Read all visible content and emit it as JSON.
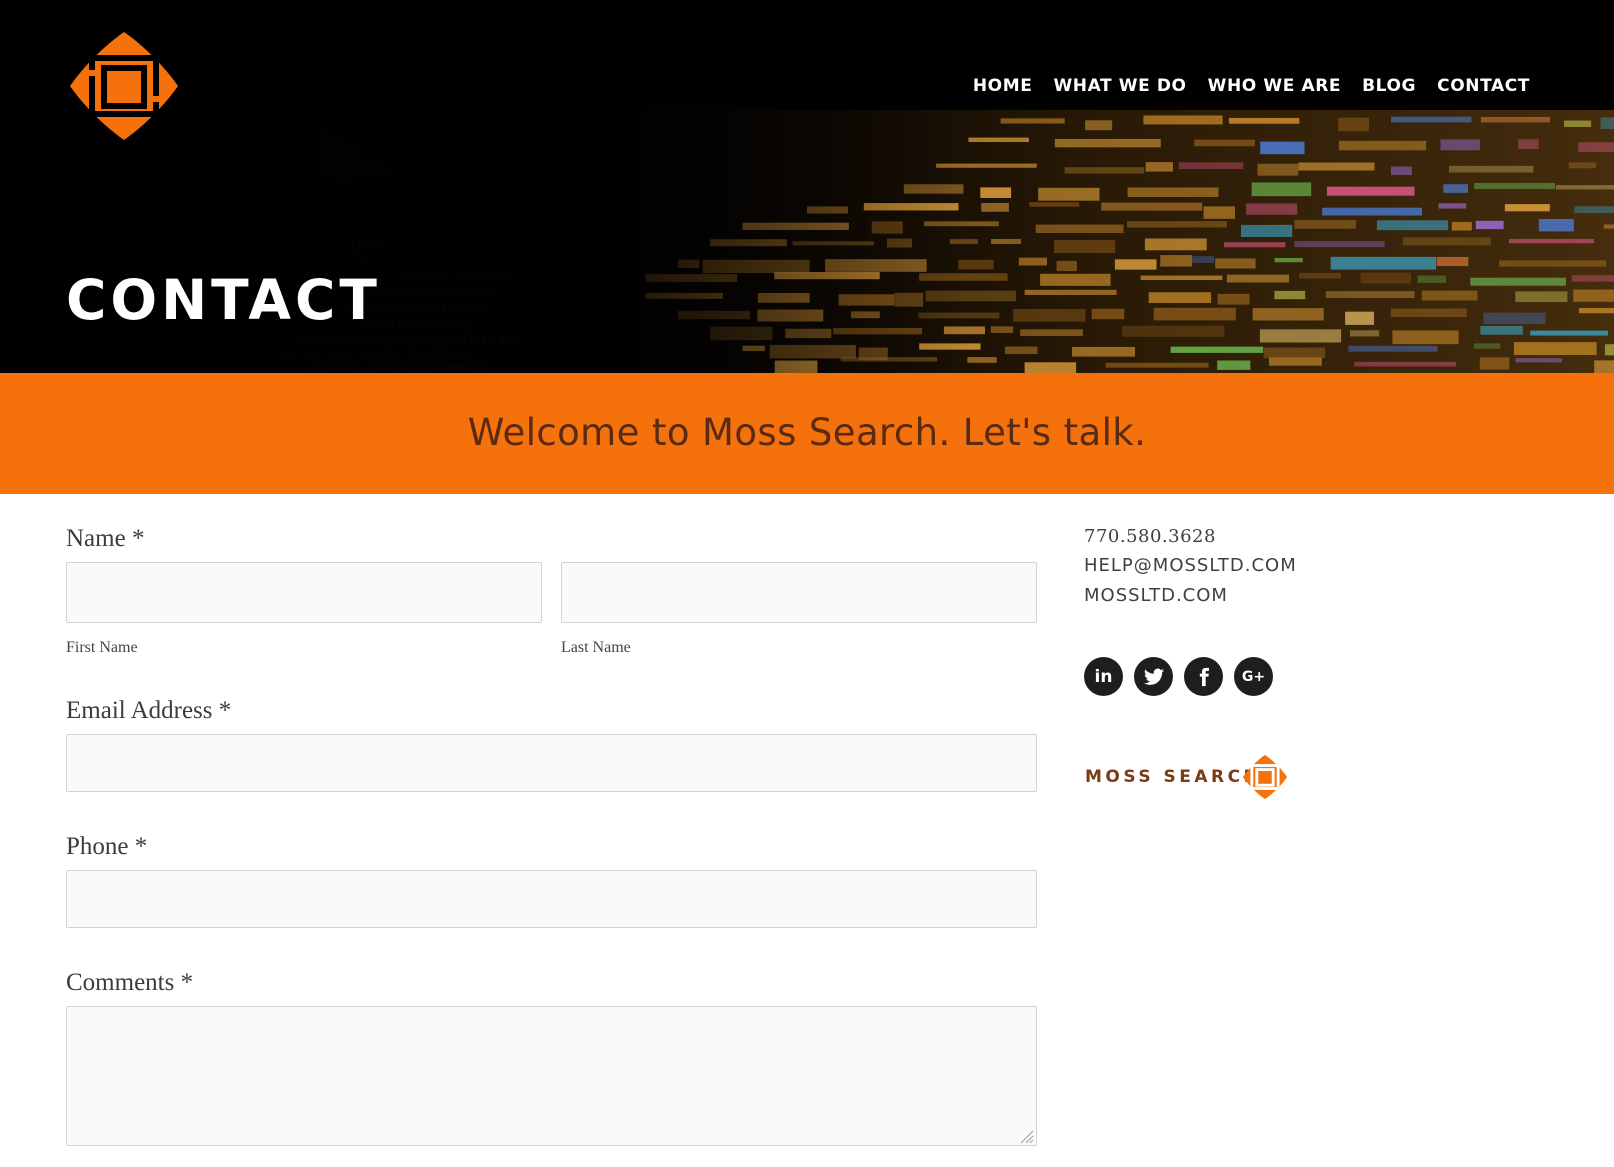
{
  "header": {
    "nav": [
      "HOME",
      "WHAT WE DO",
      "WHO WE ARE",
      "BLOG",
      "CONTACT"
    ],
    "page_title": "CONTACT"
  },
  "banner": {
    "text": "Welcome to Moss Search. Let's talk."
  },
  "form": {
    "name_label": "Name *",
    "first_name_sublabel": "First Name",
    "last_name_sublabel": "Last Name",
    "email_label": "Email Address *",
    "phone_label": "Phone *",
    "comments_label": "Comments *",
    "first_name_value": "",
    "last_name_value": "",
    "email_value": "",
    "phone_value": "",
    "comments_value": ""
  },
  "sidebar": {
    "phone": "770.580.3628",
    "email": "HELP@MOSSLTD.COM",
    "website": "MOSSLTD.COM",
    "social": [
      "linkedin-icon",
      "twitter-icon",
      "facebook-icon",
      "google-plus-icon"
    ],
    "brand_text": "MOSS SEARCH"
  },
  "colors": {
    "accent_orange": "#f4710b",
    "banner_text": "#5a2a12",
    "brand_text": "#7a3c16",
    "hero_background": "#020101",
    "social_circle": "#1e1e1e"
  }
}
